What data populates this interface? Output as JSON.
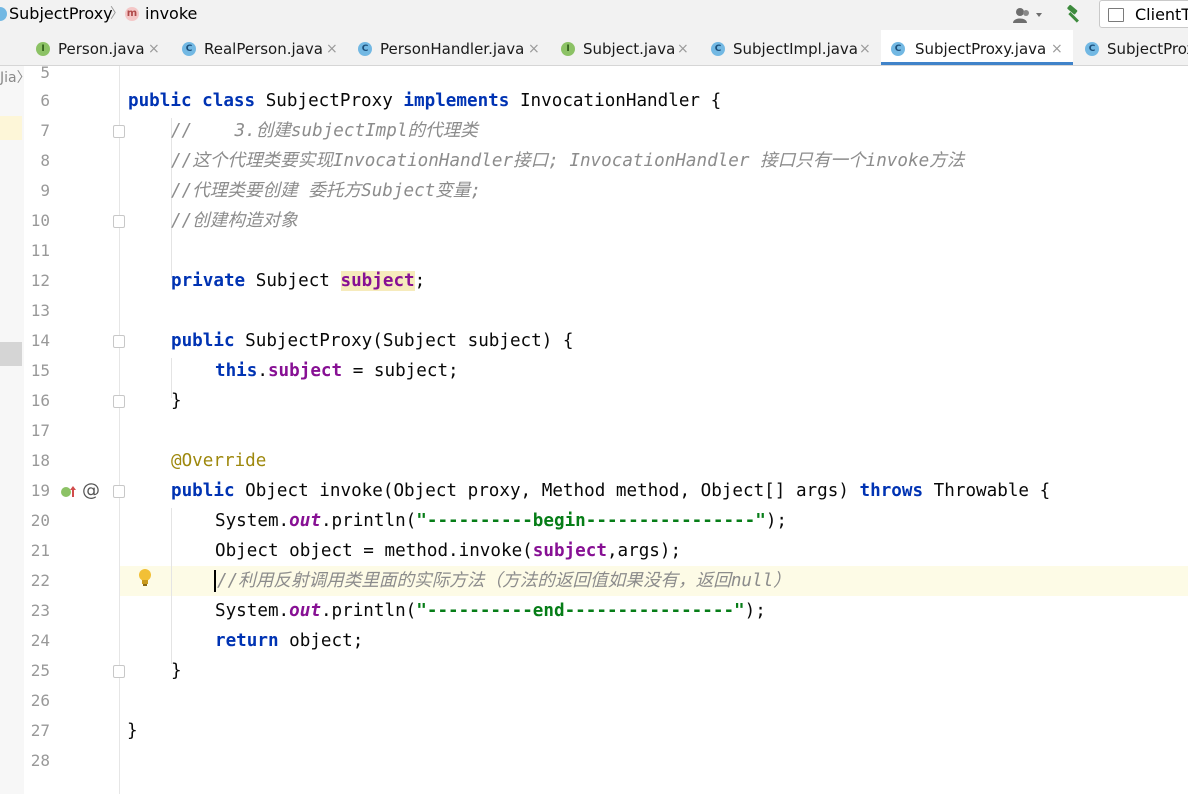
{
  "breadcrumb": {
    "file": "SubjectProxy",
    "file_badge": "c",
    "separator": "〉",
    "method": "invoke",
    "method_badge": "m"
  },
  "toolbar": {
    "run_config": "ClientTest",
    "user_icon": "user-icon",
    "build_icon": "hammer-icon"
  },
  "left_strip": {
    "text": "Jia〉"
  },
  "tabs": [
    {
      "label": "Person.java",
      "kind": "I"
    },
    {
      "label": "RealPerson.java",
      "kind": "C"
    },
    {
      "label": "PersonHandler.java",
      "kind": "C"
    },
    {
      "label": "Subject.java",
      "kind": "I"
    },
    {
      "label": "SubjectImpl.java",
      "kind": "C"
    },
    {
      "label": "SubjectProxy.java",
      "kind": "C",
      "active": true
    },
    {
      "label": "SubjectProxyTest",
      "kind": "C"
    }
  ],
  "tab_close_glyph": "×",
  "line_numbers": [
    "5",
    "6",
    "7",
    "8",
    "9",
    "10",
    "11",
    "12",
    "13",
    "14",
    "15",
    "16",
    "17",
    "18",
    "19",
    "20",
    "21",
    "22",
    "23",
    "24",
    "25",
    "26",
    "27",
    "28"
  ],
  "code": {
    "l6": {
      "kw1": "public",
      "kw2": "class",
      "name": "SubjectProxy",
      "kw3": "implements",
      "iface": "InvocationHandler {"
    },
    "l7": "//    3.创建subjectImpl的代理类",
    "l8": "//这个代理类要实现InvocationHandler接口; InvocationHandler 接口只有一个invoke方法",
    "l9": "//代理类要创建 委托方Subject变量;",
    "l10": "//创建构造对象",
    "l12": {
      "kw": "private",
      "type": "Subject",
      "field": "subject",
      "end": ";"
    },
    "l14": {
      "kw": "public",
      "rest": "SubjectProxy(Subject subject) {"
    },
    "l15": {
      "kw": "this",
      "dot": ".",
      "field": "subject",
      "rest": " = subject;"
    },
    "l16": "}",
    "l18": "@Override",
    "l19": {
      "kw": "public",
      "rest": "Object invoke(Object proxy, Method method, Object[] args)",
      "kw2": "throws",
      "rest2": "Throwable {"
    },
    "l20": {
      "a": "System.",
      "out": "out",
      "b": ".println(",
      "s": "\"----------begin----------------\"",
      "c": ");"
    },
    "l21": {
      "a": "Object object = method.invoke(",
      "field": "subject",
      "b": ",args);"
    },
    "l22": "//利用反射调用类里面的实际方法（方法的返回值如果没有，返回null）",
    "l23": {
      "a": "System.",
      "out": "out",
      "b": ".println(",
      "s": "\"----------end----------------\"",
      "c": ");"
    },
    "l24": {
      "kw": "return",
      "rest": " object;"
    },
    "l25": "}",
    "l27": "}"
  },
  "gutter_icons": {
    "implements": "implements-up-arrow-icon",
    "override": "@",
    "bulb": "lightbulb-icon"
  },
  "colors": {
    "keyword": "#0033b3",
    "comment": "#8c8c8c",
    "string": "#067d17",
    "field": "#871094",
    "annotation": "#9e880d",
    "caret_line": "#fdfbe6",
    "tab_active": "#4083c9"
  }
}
